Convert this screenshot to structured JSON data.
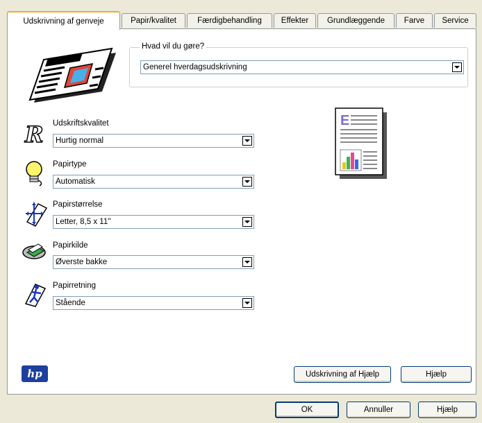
{
  "tabs": [
    {
      "label": "Udskrivning af genveje",
      "active": true
    },
    {
      "label": "Papir/kvalitet"
    },
    {
      "label": "Færdigbehandling"
    },
    {
      "label": "Effekter"
    },
    {
      "label": "Grundlæggende"
    },
    {
      "label": "Farve"
    },
    {
      "label": "Service"
    }
  ],
  "task": {
    "legend": "Hvad vil du gøre?",
    "value": "Generel hverdagsudskrivning"
  },
  "settings": {
    "quality": {
      "label": "Udskriftskvalitet",
      "value": "Hurtig normal"
    },
    "paper_type": {
      "label": "Papirtype",
      "value": "Automatisk"
    },
    "paper_size": {
      "label": "Papirstørrelse",
      "value": "Letter, 8,5 x 11''"
    },
    "paper_source": {
      "label": "Papirkilde",
      "value": "Øverste bakke"
    },
    "orientation": {
      "label": "Papirretning",
      "value": "Stående"
    }
  },
  "panel_buttons": {
    "print_help": "Udskrivning af Hjælp",
    "help": "Hjælp"
  },
  "dialog_buttons": {
    "ok": "OK",
    "cancel": "Annuller",
    "help": "Hjælp"
  },
  "logo": {
    "text": "hp",
    "color": "#1d3f9e"
  },
  "colors": {
    "tab_highlight": "#f3a82b",
    "border": "#919b9c"
  }
}
